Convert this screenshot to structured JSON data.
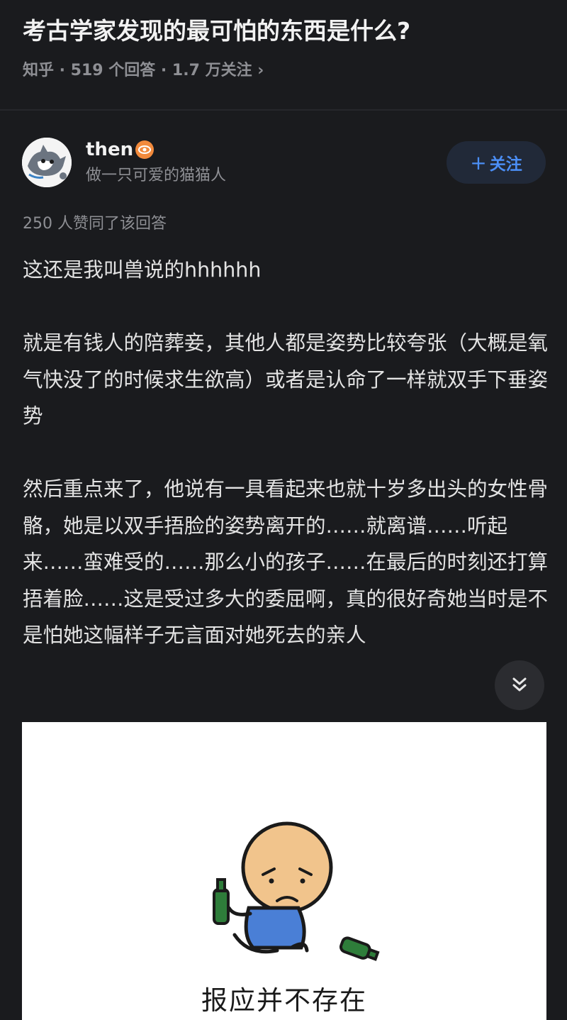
{
  "question": {
    "title": "考古学家发现的最可怕的东西是什么?",
    "meta": "知乎 · 519 个回答 · 1.7 万关注 ›"
  },
  "author": {
    "name": "then",
    "bio": "做一只可爱的猫猫人",
    "follow_label": "关注",
    "badge_icon": "eye-badge-icon"
  },
  "answer": {
    "votes": "250 人赞同了该回答",
    "paragraphs": [
      "这还是我叫兽说的hhhhhh",
      "就是有钱人的陪葬妾，其他人都是姿势比较夸张（大概是氧气快没了的时候求生欲高）或者是认命了一样就双手下垂姿势",
      "然后重点来了，他说有一具看起来也就十岁多出头的女性骨骼，她是以双手捂脸的姿势离开的……就离谱……听起来……蛮难受的……那么小的孩子……在最后的时刻还打算捂着脸……这是受过多大的委屈啊，真的很好奇她当时是不是怕她这幅样子无言面对她死去的亲人"
    ],
    "image_caption": "报应并不存在"
  },
  "colors": {
    "background": "#1a1b1e",
    "accent": "#4b8ef5",
    "muted_text": "#8e8f94"
  }
}
